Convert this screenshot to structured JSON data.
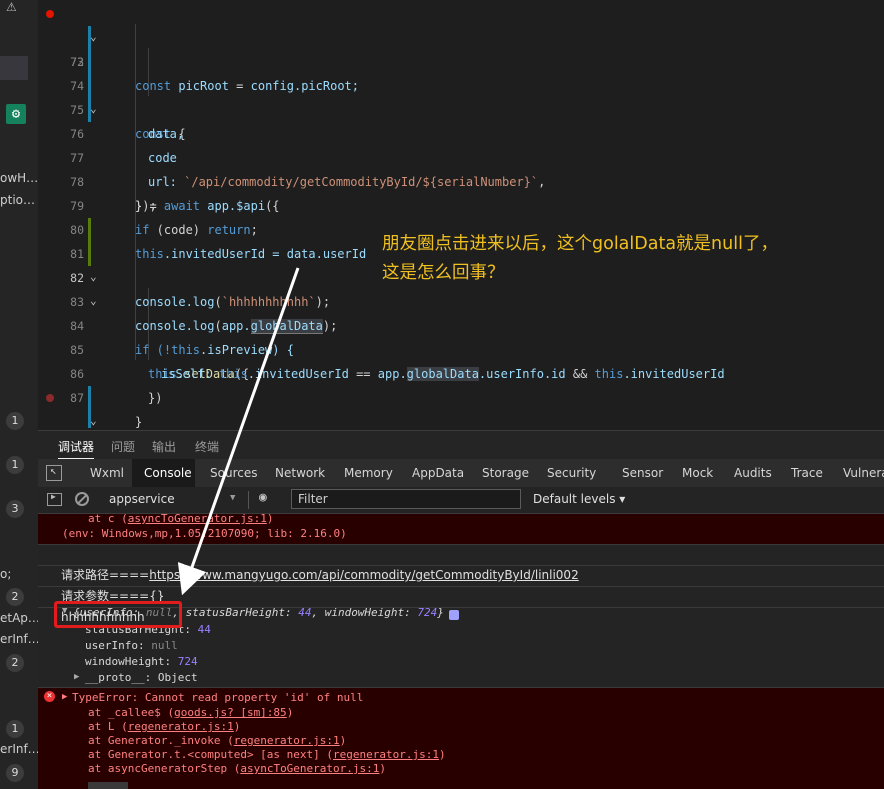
{
  "left_panel": {
    "texts": [
      "owH…",
      "ptio…",
      "o;",
      "etAp…",
      "erInf…",
      "erInf…"
    ],
    "badges": [
      "1",
      "1",
      "3",
      "2",
      "2",
      "1",
      "9"
    ],
    "warn_icon": "⚠",
    "gear_icon": "gear-icon"
  },
  "editor": {
    "question": [
      "朋友圈点击进来以后，这个golalData就是null了，",
      "这是怎么回事？"
    ],
    "lines": [
      {
        "n": "72"
      },
      {
        "n": "73"
      },
      {
        "n": "74"
      },
      {
        "n": "75"
      },
      {
        "n": "76"
      },
      {
        "n": "77"
      },
      {
        "n": "78"
      },
      {
        "n": "79"
      },
      {
        "n": "80"
      },
      {
        "n": "81"
      },
      {
        "n": "82"
      },
      {
        "n": "83"
      },
      {
        "n": "84"
      },
      {
        "n": "85"
      },
      {
        "n": "86"
      },
      {
        "n": "87"
      },
      {
        "n": "88"
      },
      {
        "n": "89"
      }
    ],
    "tok": {
      "const": "const",
      "picRoot": "picRoot",
      "eq": " = ",
      "config_picRoot": "config.picRoot;",
      "brace_open": "{",
      "data": "data,",
      "code": "code",
      "close_await": "} = ",
      "await": "await",
      "app_api": " app.$api",
      "paren_brace": "({",
      "url": "url: ",
      "url_val": "`/api/commodity/getCommodityById/${serialNumber}`",
      "comma": ",",
      "close_call": "});",
      "if": "if",
      "code_cond": " (code) ",
      "return": "return",
      "semi": ";",
      "this": "this",
      "invitedUserId_assign": ".invitedUserId = data.userId",
      "console_log": "console.log",
      "log_str": "`hhhhhhhhhhh`",
      "log_end": ");",
      "paren_open": "(",
      "app_dot": "app.",
      "globalData": "globalData",
      "if_not": "if (!",
      "isPreview": ".isPreview) {",
      "setData": ".setData",
      "isSelf": "isSelf: ",
      "invitedUserId": ".invitedUserId",
      "eqeq": " == ",
      "userInfo_id": ".userInfo.id",
      "and": " && ",
      "close_paren": "})",
      "close_brace": "}",
      "let": "let",
      "brace_sp": " {"
    }
  },
  "debugger": {
    "tabs": [
      "调试器",
      "问题",
      "输出",
      "终端"
    ],
    "devtools_tabs": [
      "Wxml",
      "Console",
      "Sources",
      "Network",
      "Memory",
      "AppData",
      "Storage",
      "Security",
      "Sensor",
      "Mock",
      "Audits",
      "Trace",
      "Vulnera"
    ],
    "context": "appservice",
    "filter_placeholder": "Filter",
    "levels": "Default levels ▾"
  },
  "console": {
    "err_top_1a": "at c (",
    "err_top_1b": "asyncToGenerator.js:1",
    "err_top_1c": ")",
    "err_top_2": "(env: Windows,mp,1.05.2107090; lib: 2.16.0)",
    "req_path_label": "请求路径====",
    "req_path_url": "https://www.mangyugo.com/api/commodity/getCommodityById/linli002",
    "req_params": "请求参数===={}",
    "hhh": "hhhhhhhhhhh",
    "obj_brace": "{",
    "obj_userInfo_key": "userInfo: ",
    "obj_userInfo_val": "null",
    "obj_rest_a": ", statusBarHeight: ",
    "obj_sbh": "44",
    "obj_rest_b": ", windowHeight: ",
    "obj_wh": "724",
    "obj_close": "}",
    "prop_sbh_key": "statusBarHeight: ",
    "prop_sbh_val": "44",
    "prop_ui_key": "userInfo: ",
    "prop_ui_val": "null",
    "prop_wh_key": "windowHeight: ",
    "prop_wh_val": "724",
    "prop_proto": "__proto__: Object",
    "type_error": "TypeError: Cannot read property 'id' of null",
    "stack": [
      {
        "pre": "at _callee$ (",
        "file": "goods.js? [sm]:85",
        "post": ")"
      },
      {
        "pre": "at L (",
        "file": "regenerator.js:1",
        "post": ")"
      },
      {
        "pre": "at Generator._invoke (",
        "file": "regenerator.js:1",
        "post": ")"
      },
      {
        "pre": "at Generator.t.<computed> [as next] (",
        "file": "regenerator.js:1",
        "post": ")"
      },
      {
        "pre": "at asyncGeneratorStep (",
        "file": "asyncToGenerator.js:1",
        "post": ")"
      }
    ]
  },
  "colors": {
    "annotation": "#f0c020",
    "highlight_box": "#e21c1c",
    "arrow": "#ffffff"
  }
}
